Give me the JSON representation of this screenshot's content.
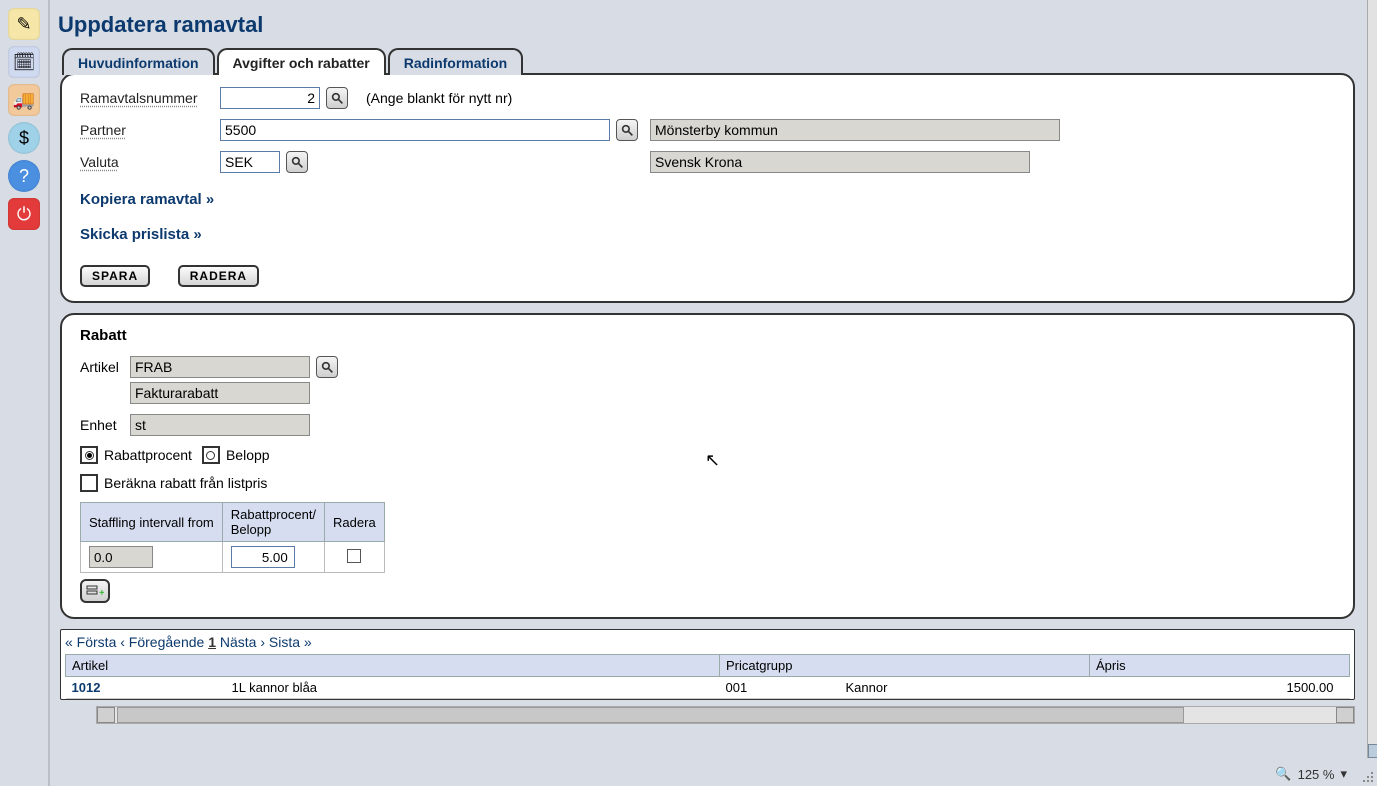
{
  "header": {
    "title": "Uppdatera ramavtal"
  },
  "tabs": [
    {
      "label": "Huvudinformation"
    },
    {
      "label": "Avgifter och rabatter"
    },
    {
      "label": "Radinformation"
    }
  ],
  "form": {
    "ramavtal_label": "Ramavtalsnummer",
    "ramavtal_value": "2",
    "ramavtal_hint": "(Ange blankt för nytt nr)",
    "partner_label": "Partner",
    "partner_value": "5500",
    "partner_name": "Mönsterby kommun",
    "valuta_label": "Valuta",
    "valuta_value": "SEK",
    "valuta_name": "Svensk Krona"
  },
  "links": {
    "kopiera": "Kopiera ramavtal »",
    "skicka": "Skicka prislista »"
  },
  "buttons": {
    "spara": "SPARA",
    "radera": "RADERA"
  },
  "rabatt": {
    "title": "Rabatt",
    "artikel_label": "Artikel",
    "artikel_value": "FRAB",
    "artikel_name": "Fakturarabatt",
    "enhet_label": "Enhet",
    "enhet_value": "st",
    "radio_percent_label": "Rabattprocent",
    "radio_belopp_label": "Belopp",
    "check_listpris_label": "Beräkna rabatt från listpris",
    "table": {
      "col1": "Staffling intervall from",
      "col2": "Rabattprocent/\nBelopp",
      "col3": "Radera",
      "row": {
        "from": "0.0",
        "percent": "5.00"
      }
    }
  },
  "grid": {
    "pager": {
      "first": "« Första",
      "prev": "‹ Föregående",
      "current": "1",
      "next": "Nästa ›",
      "last": "Sista »"
    },
    "cols": {
      "artikel": "Artikel",
      "pricat": "Pricatgrupp",
      "apris": "Ápris"
    },
    "rows": [
      {
        "id": "1012",
        "desc": "1L kannor blåa",
        "pricat_code": "001",
        "pricat_name": "Kannor",
        "apris": "1500.00"
      }
    ]
  },
  "status": {
    "zoom": "125 %"
  }
}
